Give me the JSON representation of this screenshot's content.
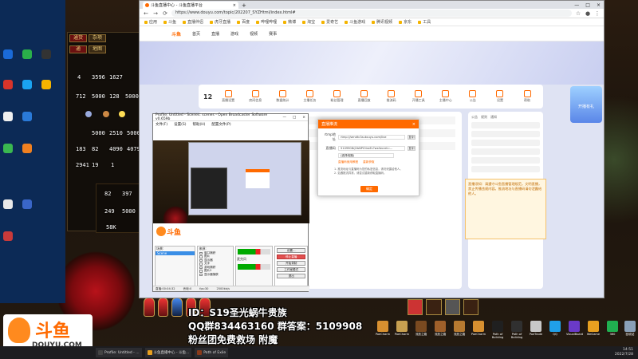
{
  "colors": {
    "brand": "#ff6a00",
    "obs_active": "#e25050",
    "scene_sel": "#3a8ee6"
  },
  "game": {
    "inv_tabs": [
      "通货",
      "杂项",
      "通",
      "地图"
    ],
    "stacks": [
      "4",
      "3596",
      "1627",
      "712",
      "5000",
      "128",
      "5000",
      "5000",
      "2510",
      "5000",
      "183",
      "82",
      "4090",
      "4079",
      "2941",
      "19",
      "1",
      "82",
      "397",
      "249",
      "5000",
      "58K"
    ]
  },
  "browser": {
    "tab_title": "斗鱼直播中心 - 斗鱼直播平台",
    "url": "https://www.douyu.com/topic/202207_SYZHtml/index.html#",
    "bookmarks": [
      "应用",
      "斗鱼",
      "直播伴侣",
      "虎牙直播",
      "百度",
      "哔哩哔哩",
      "微博",
      "淘宝",
      "爱奇艺",
      "斗鱼游戏",
      "腾讯视频",
      "京东",
      "工具"
    ],
    "nav": [
      "首页",
      "直播",
      "游戏",
      "视频",
      "赛事"
    ],
    "tool_count": "12",
    "tools": [
      "直播设置",
      "房间信息",
      "数据统计",
      "主播任务",
      "粉丝管理",
      "直播回放",
      "推流码",
      "开播工具",
      "主播中心",
      "公告",
      "设置",
      "帮助"
    ],
    "side_tabs": [
      "公告",
      "规则",
      "通知"
    ],
    "notice": "直播须知：请遵守斗鱼直播管理规范，文明直播，禁止传播违规内容。推流地址与直播码请勿泄露给他人。",
    "right_ad": "开播有礼"
  },
  "dialog": {
    "title": "直播推流",
    "close": "×",
    "rtmp_label": "rtmp地址",
    "rtmp_value": "rtmp://sendtc3a.douyu.com/live",
    "copy": "复制",
    "key_label": "直播码",
    "key_value": "5109908rJ2bNPlOiraEL?wsSecret=...",
    "select_value": "(选择线路)",
    "link1": "直播码使用教程",
    "link2": "重新获取",
    "note1": "1. 推流地址与直播码为您的私密信息，请勿泄露给他人。",
    "note2": "2. 如遇推流异常，请尝试重新获取直播码。",
    "ok": "确定"
  },
  "obs": {
    "title": "Profile: Untitled - Scenes: scenes - Open Broadcaster Software v0.659b",
    "menu": [
      "文件(F)",
      "设置(S)",
      "帮助(H)",
      "配置文件(P)"
    ],
    "brand": "斗鱼",
    "scenes_label": "场景:",
    "scene": "Scene",
    "sources_label": "来源:",
    "sources": [
      "窗口捕获",
      "图片",
      "显示器",
      "文字",
      "游戏捕获",
      "图片2",
      "显示器捕获"
    ],
    "buttons": [
      "设置…",
      "停止直播",
      "开始录制",
      "工作室模式",
      "退出"
    ],
    "mic_label": "麦克风",
    "status": [
      "直播:00:04:32",
      "丢帧:0",
      "fps:30",
      "2500kb/s"
    ]
  },
  "overlay": {
    "line1": "ID：S19圣光蜗牛贵族",
    "line2": "QQ群834463160 群答案：5109908",
    "line3": "粉丝团免费救场 附魔"
  },
  "douyu": {
    "cn": "斗鱼",
    "en": "DOUYU.COM"
  },
  "taskbar": {
    "tasks": [
      "Profile: Untitled - ...",
      "斗鱼直播中心 - 斗鱼...",
      "Path of Exile"
    ],
    "time": "14:51",
    "date": "2022/7/28"
  },
  "shortcuts": [
    "PoeCharm",
    "PoeCharm",
    "流放之路",
    "流放之路",
    "流放之路",
    "PoeCharm",
    "Path of Building",
    "Path of Building",
    "PoeTrade",
    "QQ",
    "VisualBoard",
    "WeGame",
    "360",
    "回收站"
  ]
}
